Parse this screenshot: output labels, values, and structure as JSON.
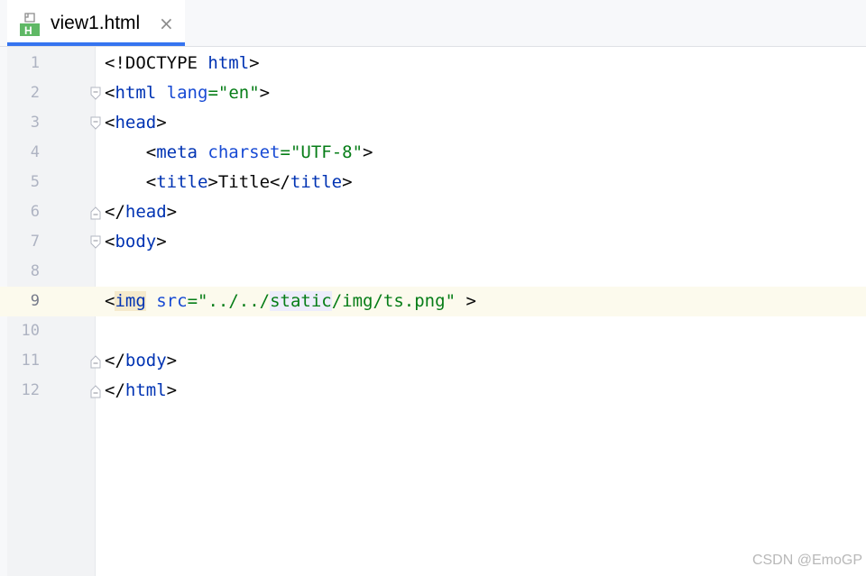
{
  "tab": {
    "label": "view1.html",
    "icon": "html-file-icon",
    "icon_letter": "H",
    "close_glyph": "×",
    "accent_color": "#3574f0"
  },
  "editor": {
    "current_line": 9,
    "lines": [
      {
        "num": "1",
        "fold": "none"
      },
      {
        "num": "2",
        "fold": "open"
      },
      {
        "num": "3",
        "fold": "open"
      },
      {
        "num": "4",
        "fold": "none"
      },
      {
        "num": "5",
        "fold": "none"
      },
      {
        "num": "6",
        "fold": "end"
      },
      {
        "num": "7",
        "fold": "open"
      },
      {
        "num": "8",
        "fold": "none"
      },
      {
        "num": "9",
        "fold": "none"
      },
      {
        "num": "10",
        "fold": "none"
      },
      {
        "num": "11",
        "fold": "end"
      },
      {
        "num": "12",
        "fold": "end"
      }
    ],
    "tokens": {
      "l1_a": "<!DOCTYPE ",
      "l1_b": "html",
      "l1_c": ">",
      "l2_a": "<",
      "l2_b": "html",
      "l2_c": " ",
      "l2_d": "lang",
      "l2_e": "=",
      "l2_f": "\"en\"",
      "l2_g": ">",
      "l3_a": "<",
      "l3_b": "head",
      "l3_c": ">",
      "l4_a": "    <",
      "l4_b": "meta",
      "l4_c": " ",
      "l4_d": "charset",
      "l4_e": "=",
      "l4_f": "\"UTF-8\"",
      "l4_g": ">",
      "l5_a": "    <",
      "l5_b": "title",
      "l5_c": ">Title</",
      "l5_d": "title",
      "l5_e": ">",
      "l6_a": "</",
      "l6_b": "head",
      "l6_c": ">",
      "l7_a": "<",
      "l7_b": "body",
      "l7_c": ">",
      "l9_a": "<",
      "l9_b": "img",
      "l9_c": " ",
      "l9_d": "src",
      "l9_e": "=",
      "l9_f": "\"../../",
      "l9_g": "static",
      "l9_h": "/img/ts.png\"",
      "l9_i": " >",
      "l11_a": "</",
      "l11_b": "body",
      "l11_c": ">",
      "l12_a": "</",
      "l12_b": "html",
      "l12_c": ">"
    }
  },
  "colors": {
    "tag": "#0033b3",
    "attribute": "#174ad4",
    "string": "#067d17",
    "current_line_bg": "#fcfaed"
  },
  "watermark": "CSDN @EmoGP"
}
